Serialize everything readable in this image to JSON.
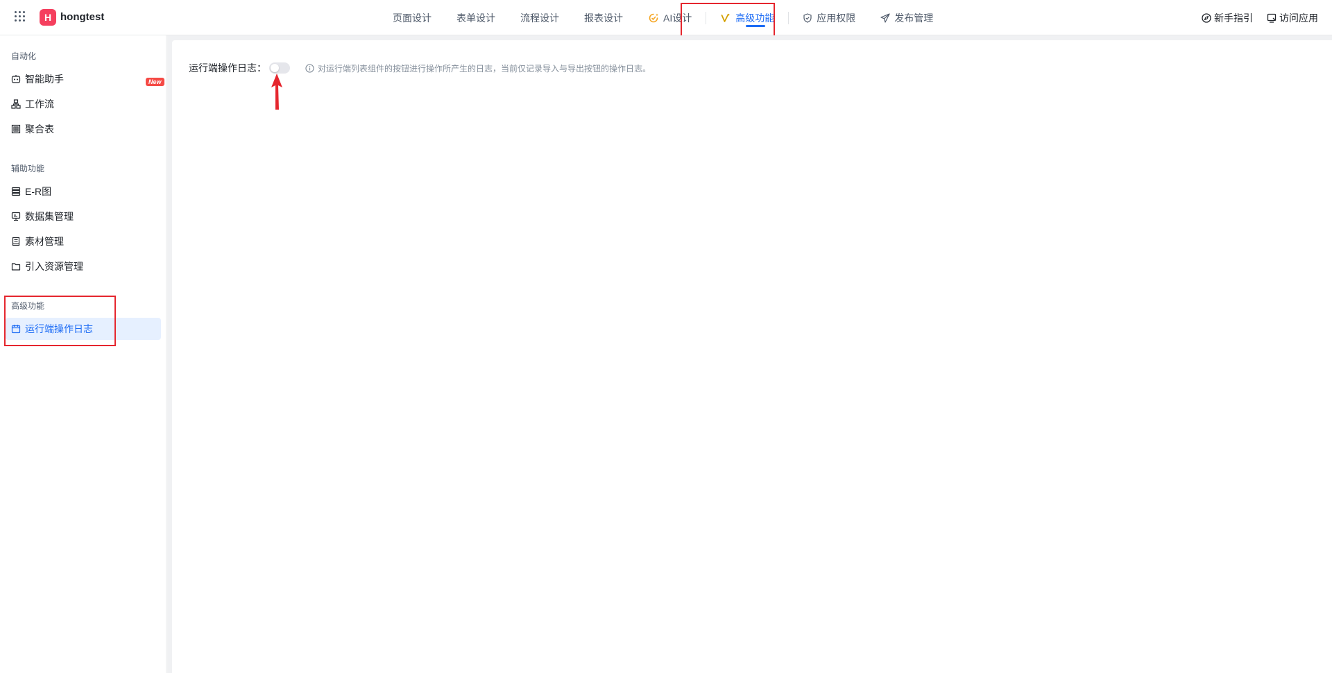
{
  "header": {
    "app_logo_letter": "H",
    "app_name": "hongtest",
    "nav": [
      {
        "label": "页面设计",
        "icon": "none"
      },
      {
        "label": "表单设计",
        "icon": "none"
      },
      {
        "label": "流程设计",
        "icon": "none"
      },
      {
        "label": "报表设计",
        "icon": "none"
      },
      {
        "label": "AI设计",
        "icon": "ai-sparkle-icon"
      },
      {
        "label": "高级功能",
        "icon": "advanced-feature-icon",
        "active": true
      },
      {
        "label": "应用权限",
        "icon": "shield-icon"
      },
      {
        "label": "发布管理",
        "icon": "send-icon"
      }
    ],
    "right": {
      "guide_label": "新手指引",
      "visit_label": "访问应用"
    }
  },
  "sidebar": {
    "groups": [
      {
        "title": "自动化",
        "items": [
          {
            "label": "智能助手",
            "icon": "robot-icon"
          },
          {
            "label": "工作流",
            "icon": "workflow-icon",
            "badge": "New"
          },
          {
            "label": "聚合表",
            "icon": "aggregate-table-icon"
          }
        ]
      },
      {
        "title": "辅助功能",
        "items": [
          {
            "label": "E-R图",
            "icon": "er-diagram-icon"
          },
          {
            "label": "数据集管理",
            "icon": "dataset-icon"
          },
          {
            "label": "素材管理",
            "icon": "material-icon"
          },
          {
            "label": "引入资源管理",
            "icon": "folder-icon"
          }
        ]
      },
      {
        "title": "高级功能",
        "items": [
          {
            "label": "运行端操作日志",
            "icon": "calendar-icon",
            "selected": true
          }
        ]
      }
    ]
  },
  "main": {
    "setting_label": "运行端操作日志：",
    "toggle_on": false,
    "hint": "对运行端列表组件的按钮进行操作所产生的日志，当前仅记录导入与导出按钮的操作日志。"
  },
  "colors": {
    "accent": "#1d6cf5",
    "annotation_red": "#e5262e",
    "logo_bg": "#f53f5e",
    "badge_red": "#f54a45",
    "selected_bg": "#e6f0ff"
  }
}
